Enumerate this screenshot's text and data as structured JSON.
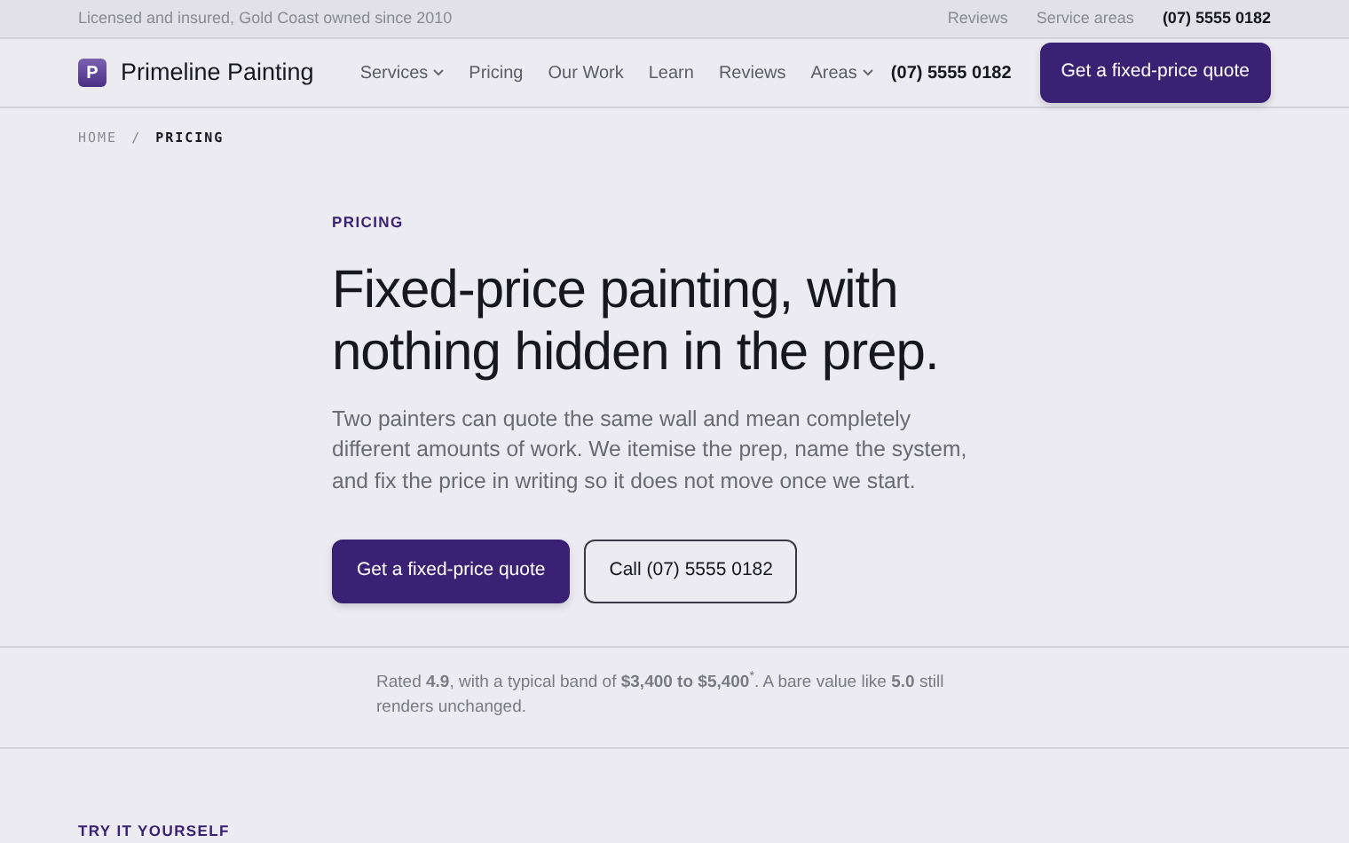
{
  "topbar": {
    "tagline": "Licensed and insured, Gold Coast owned since 2010",
    "links": [
      "Reviews",
      "Service areas"
    ],
    "phone": "(07) 5555 0182"
  },
  "navbar": {
    "logo_letter": "P",
    "brand": "Primeline Painting",
    "items": [
      {
        "label": "Services",
        "dropdown": true
      },
      {
        "label": "Pricing",
        "dropdown": false
      },
      {
        "label": "Our Work",
        "dropdown": false
      },
      {
        "label": "Learn",
        "dropdown": false
      },
      {
        "label": "Reviews",
        "dropdown": false
      },
      {
        "label": "Areas",
        "dropdown": true
      }
    ],
    "phone": "(07) 5555 0182",
    "cta": "Get a fixed-price quote"
  },
  "breadcrumb": {
    "separator": "/",
    "items": [
      "HOME",
      "PRICING"
    ]
  },
  "hero": {
    "eyebrow": "PRICING",
    "title": "Fixed-price painting, with nothing hidden in the prep.",
    "lead": "Two painters can quote the same wall and mean completely different amounts of work. We itemise the prep, name the system, and fix the price in writing so it does not move once we start.",
    "buttons": [
      {
        "label": "Get a fixed-price quote",
        "kind": "primary"
      },
      {
        "label": "Call (07) 5555 0182",
        "kind": "outline"
      }
    ]
  },
  "rating_note": "Rated **4.9**, with a typical band of **$3,400 to $5,400**$^{*}$. A bare value like **5.0** still renders unchanged.",
  "next_section": {
    "eyebrow": "TRY IT YOURSELF"
  }
}
